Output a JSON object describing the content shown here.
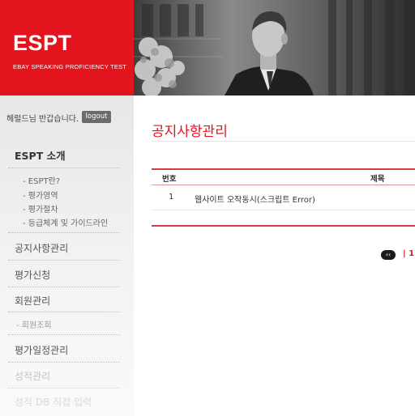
{
  "brand": {
    "title": "ESPT",
    "subtitle": "EBAY SPEAKING PROFICIENCY TEST"
  },
  "user": {
    "greeting": "헤럴드님 반갑습니다.",
    "logout_label": "logout"
  },
  "sidebar": {
    "section_title": "ESPT 소개",
    "sub_items": [
      "- ESPT란?",
      "- 평가영역",
      "- 평가절차",
      "- 등급체계 및 가이드라인"
    ],
    "menu": {
      "notice": "공지사항관리",
      "apply": "평가신청",
      "members": "회원관리",
      "member_search": "- 회원조회",
      "schedule": "평가일정관리",
      "grades": "성적관리",
      "grade_entry": "성적 DB 직접 입력"
    }
  },
  "main": {
    "page_title": "공지사항관리",
    "columns": {
      "no": "번호",
      "title": "제목"
    },
    "rows": [
      {
        "no": "1",
        "title": "웹사이트 오작동시(스크립트 Error)"
      }
    ],
    "pagination": {
      "first_icon": "double-left-arrow-icon",
      "first_glyph": "‹‹",
      "current": "| 1"
    }
  },
  "colors": {
    "brand_red": "#e3141d",
    "table_rule_red": "#d93a3a",
    "sidebar_gray": "#e7e7e7"
  }
}
